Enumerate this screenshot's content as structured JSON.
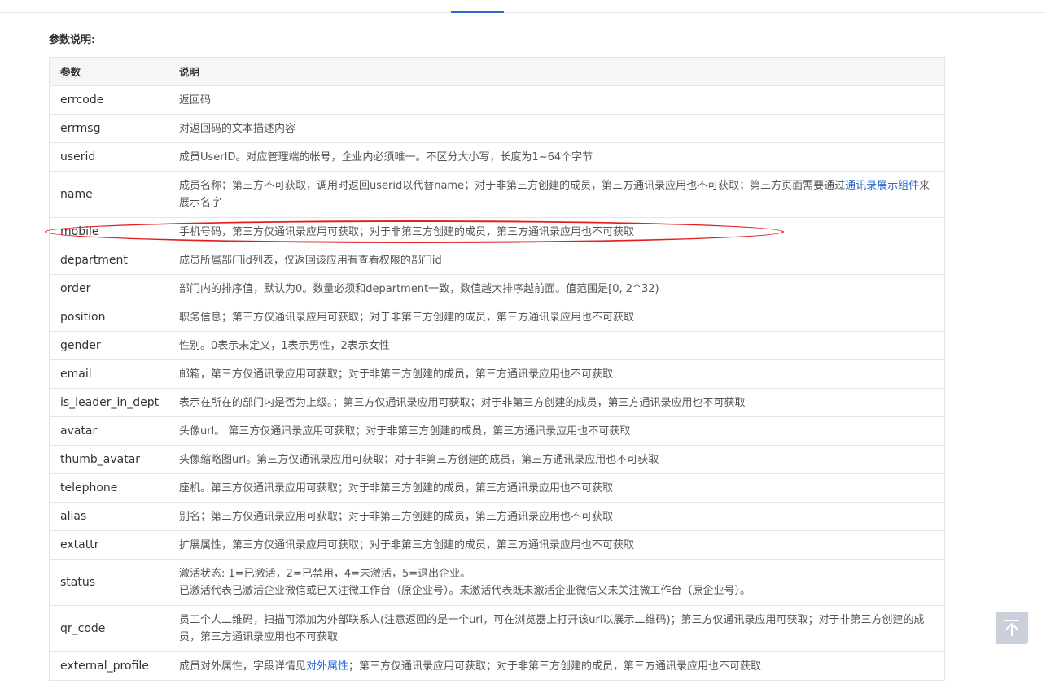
{
  "section_title": "参数说明:",
  "table": {
    "headers": [
      "参数",
      "说明"
    ],
    "rows": [
      {
        "name": "errcode",
        "desc": "返回码"
      },
      {
        "name": "errmsg",
        "desc": "对返回码的文本描述内容"
      },
      {
        "name": "userid",
        "desc": "成员UserID。对应管理端的帐号，企业内必须唯一。不区分大小写，长度为1~64个字节"
      },
      {
        "name": "name",
        "desc_before": "成员名称；第三方不可获取，调用时返回userid以代替name；对于非第三方创建的成员，第三方通讯录应用也不可获取；第三方页面需要通过",
        "desc_link": "通讯录展示组件",
        "desc_after": "来展示名字"
      },
      {
        "name": "mobile",
        "desc": "手机号码，第三方仅通讯录应用可获取；对于非第三方创建的成员，第三方通讯录应用也不可获取"
      },
      {
        "name": "department",
        "desc": "成员所属部门id列表，仅返回该应用有查看权限的部门id"
      },
      {
        "name": "order",
        "desc": "部门内的排序值，默认为0。数量必须和department一致，数值越大排序越前面。值范围是[0, 2^32)"
      },
      {
        "name": "position",
        "desc": "职务信息；第三方仅通讯录应用可获取；对于非第三方创建的成员，第三方通讯录应用也不可获取"
      },
      {
        "name": "gender",
        "desc": "性别。0表示未定义，1表示男性，2表示女性"
      },
      {
        "name": "email",
        "desc": "邮箱，第三方仅通讯录应用可获取；对于非第三方创建的成员，第三方通讯录应用也不可获取"
      },
      {
        "name": "is_leader_in_dept",
        "desc": "表示在所在的部门内是否为上级。；第三方仅通讯录应用可获取；对于非第三方创建的成员，第三方通讯录应用也不可获取"
      },
      {
        "name": "avatar",
        "desc": "头像url。 第三方仅通讯录应用可获取；对于非第三方创建的成员，第三方通讯录应用也不可获取"
      },
      {
        "name": "thumb_avatar",
        "desc": "头像缩略图url。第三方仅通讯录应用可获取；对于非第三方创建的成员，第三方通讯录应用也不可获取"
      },
      {
        "name": "telephone",
        "desc": "座机。第三方仅通讯录应用可获取；对于非第三方创建的成员，第三方通讯录应用也不可获取"
      },
      {
        "name": "alias",
        "desc": "别名；第三方仅通讯录应用可获取；对于非第三方创建的成员，第三方通讯录应用也不可获取"
      },
      {
        "name": "extattr",
        "desc": "扩展属性，第三方仅通讯录应用可获取；对于非第三方创建的成员，第三方通讯录应用也不可获取"
      },
      {
        "name": "status",
        "desc_line1": "激活状态: 1=已激活，2=已禁用，4=未激活，5=退出企业。",
        "desc_line2": "已激活代表已激活企业微信或已关注微工作台（原企业号）。未激活代表既未激活企业微信又未关注微工作台（原企业号）。"
      },
      {
        "name": "qr_code",
        "desc": "员工个人二维码，扫描可添加为外部联系人(注意返回的是一个url，可在浏览器上打开该url以展示二维码)；第三方仅通讯录应用可获取；对于非第三方创建的成员，第三方通讯录应用也不可获取"
      },
      {
        "name": "external_profile",
        "desc_before": "成员对外属性，字段详情见",
        "desc_link": "对外属性",
        "desc_after": "；第三方仅通讯录应用可获取；对于非第三方创建的成员，第三方通讯录应用也不可获取"
      }
    ]
  },
  "highlight": {
    "row": "mobile",
    "color": "#e02020"
  },
  "colors": {
    "accent": "#2e6bd1",
    "header_bg": "#f5f6f7",
    "border": "#e3e5e8",
    "back_to_top_bg": "#c9d0d9"
  },
  "back_to_top": {
    "icon": "arrow-up-to-top-icon"
  }
}
